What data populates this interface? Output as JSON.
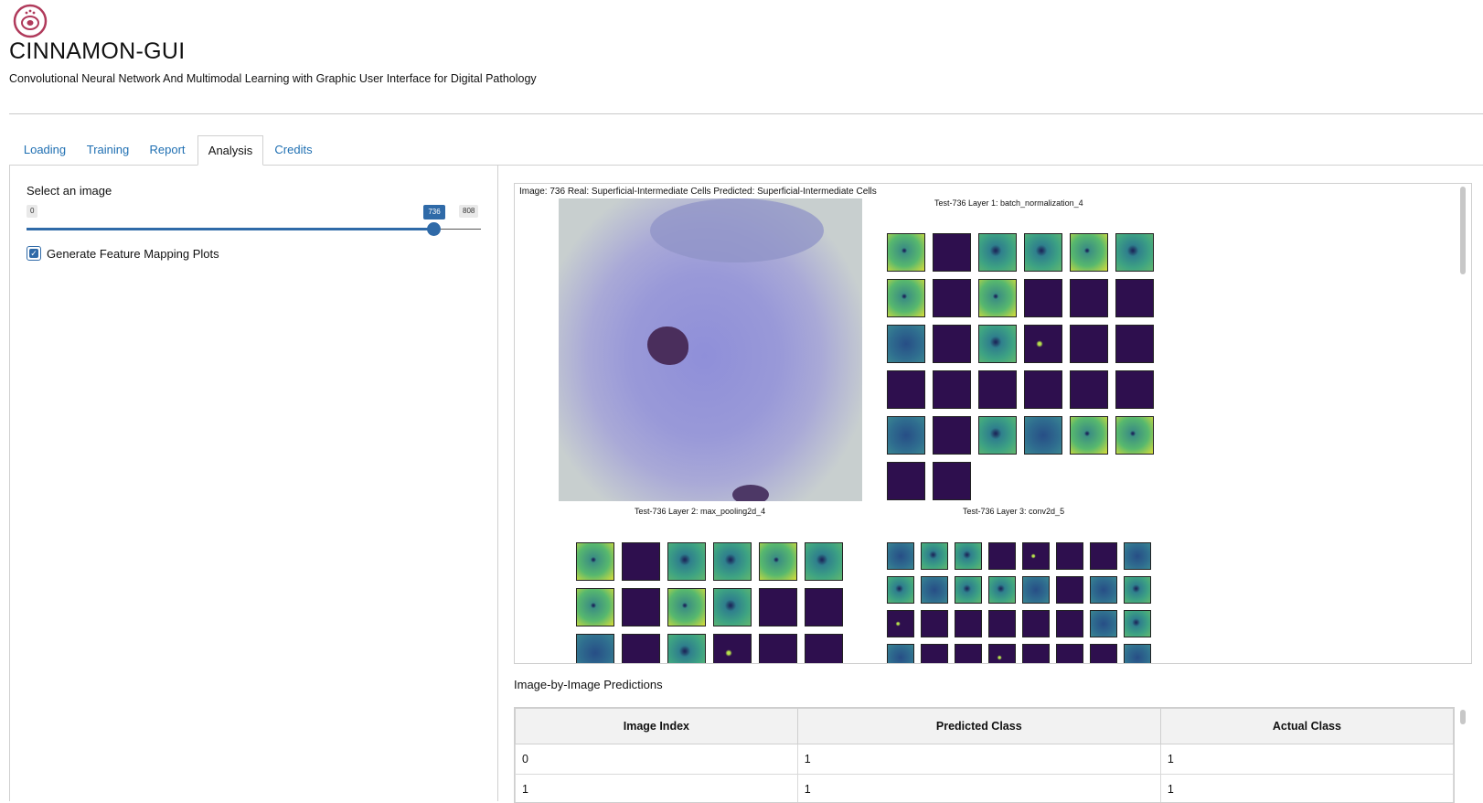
{
  "app": {
    "title": "CINNAMON-GUI",
    "subtitle": "Convolutional Neural Network And Multimodal Learning with Graphic User Interface for Digital Pathology"
  },
  "tabs": [
    {
      "label": "Loading",
      "active": false
    },
    {
      "label": "Training",
      "active": false
    },
    {
      "label": "Report",
      "active": false
    },
    {
      "label": "Analysis",
      "active": true
    },
    {
      "label": "Credits",
      "active": false
    }
  ],
  "controls": {
    "select_label": "Select an image",
    "slider": {
      "min": "0",
      "max": "808",
      "value": "736"
    },
    "checkbox_label": "Generate Feature Mapping Plots",
    "checkbox_checked": true
  },
  "plots": {
    "caption": "Image: 736 Real: Superficial-Intermediate Cells Predicted: Superficial-Intermediate Cells",
    "layer1_title": "Test-736 Layer 1: batch_normalization_4",
    "layer2_title": "Test-736 Layer 2: max_pooling2d_4",
    "layer3_title": "Test-736 Layer 3: conv2d_5"
  },
  "predictions": {
    "title": "Image-by-Image Predictions",
    "columns": [
      "Image Index",
      "Predicted Class",
      "Actual Class"
    ],
    "rows": [
      [
        "0",
        "1",
        "1"
      ],
      [
        "1",
        "1",
        "1"
      ]
    ]
  },
  "colors": {
    "accent": "#2f6aa8",
    "link": "#1f6fb2",
    "feature_dark": "#2e0f4e",
    "logo": "#b03a5b"
  }
}
